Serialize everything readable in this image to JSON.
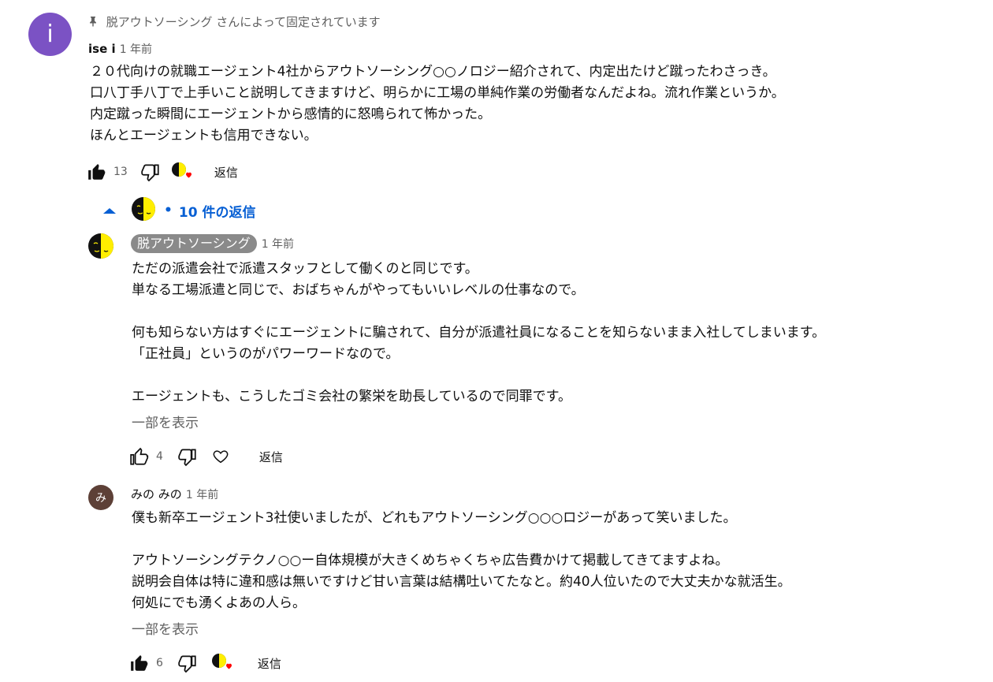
{
  "pinned": {
    "text": "脱アウトソーシング さんによって固定されています"
  },
  "top_comment": {
    "avatar_letter": "i",
    "avatar_color": "#7b52c4",
    "author": "ise i",
    "time": "1 年前",
    "text": "２０代向けの就職エージェント4社からアウトソーシング○○ノロジー紹介されて、内定出たけど蹴ったわさっき。\n口八丁手八丁で上手いこと説明してきますけど、明らかに工場の単純作業の労働者なんだよね。流れ作業というか。\n内定蹴った瞬間にエージェントから感情的に怒鳴られて怖かった。\nほんとエージェントも信用できない。",
    "likes": "13",
    "reply_label": "返信"
  },
  "replies_toggle": {
    "label": "10 件の返信",
    "dot": "•"
  },
  "replies": [
    {
      "author_badge": "脱アウトソーシング",
      "time": "1 年前",
      "text": "ただの派遣会社で派遣スタッフとして働くのと同じです。\n単なる工場派遣と同じで、おばちゃんがやってもいいレベルの仕事なので。\n\n何も知らない方はすぐにエージェントに騙されて、自分が派遣社員になることを知らないまま入社してしまいます。\n「正社員」というのがパワーワードなので。\n\nエージェントも、こうしたゴミ会社の繁栄を助長しているので同罪です。",
      "show_more": "一部を表示",
      "likes": "4",
      "reply_label": "返信"
    },
    {
      "avatar_letter": "み",
      "avatar_color": "#5d4037",
      "author": "みの みの",
      "time": "1 年前",
      "text": "僕も新卒エージェント3社使いましたが、どれもアウトソーシング○○○ロジーがあって笑いました。\n\nアウトソーシングテクノ○○ー自体規模が大きくめちゃくちゃ広告費かけて掲載してきてますよね。\n説明会自体は特に違和感は無いですけど甘い言葉は結構吐いてたなと。約40人位いたので大丈夫かな就活生。\n何処にでも湧くよあの人ら。",
      "show_more": "一部を表示",
      "likes": "6",
      "reply_label": "返信"
    }
  ],
  "colors": {
    "link_blue": "#065fd4",
    "heart_red": "#ff0000",
    "mask_yellow": "#ffee00"
  }
}
